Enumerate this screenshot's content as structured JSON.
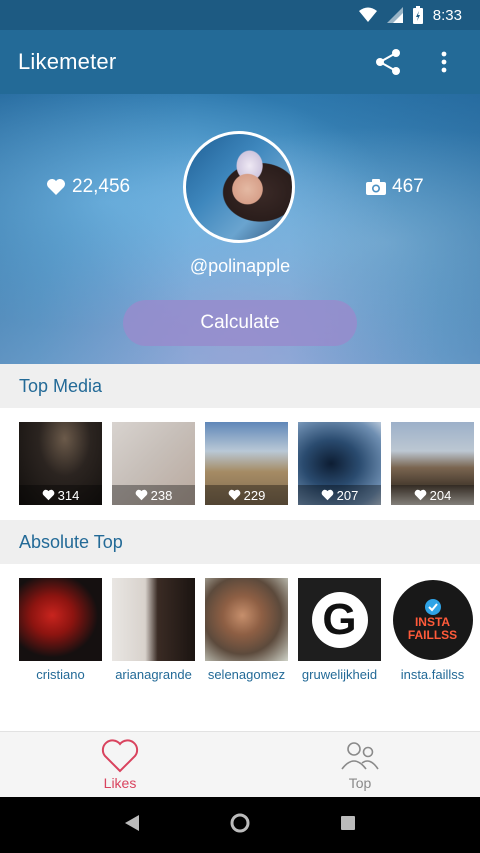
{
  "status_bar": {
    "time": "8:33"
  },
  "app_bar": {
    "title": "Likemeter",
    "share_icon": "share-icon",
    "more_icon": "more-vert-icon"
  },
  "profile": {
    "likes": "22,456",
    "posts": "467",
    "username": "@polinapple",
    "calculate_label": "Calculate"
  },
  "sections": {
    "top_media": "Top Media",
    "absolute_top": "Absolute Top"
  },
  "top_media": [
    {
      "likes": "314"
    },
    {
      "likes": "238"
    },
    {
      "likes": "229"
    },
    {
      "likes": "207"
    },
    {
      "likes": "204"
    }
  ],
  "absolute_top": [
    {
      "name": "cristiano"
    },
    {
      "name": "arianagrande"
    },
    {
      "name": "selenagomez"
    },
    {
      "name": "gruwelijkheid"
    },
    {
      "name": "insta.faillss"
    }
  ],
  "bottom_nav": {
    "likes_label": "Likes",
    "top_label": "Top"
  },
  "colors": {
    "primary": "#236a97",
    "accent": "#d9435e"
  }
}
